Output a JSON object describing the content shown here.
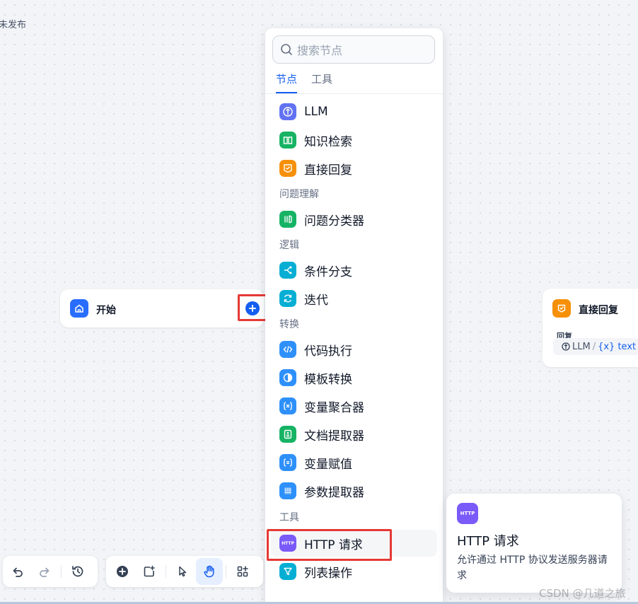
{
  "status": {
    "text": "未发布"
  },
  "start_node": {
    "title": "开始",
    "icon": "home-icon",
    "color": "#296dff"
  },
  "answer_node": {
    "title": "直接回复",
    "icon": "reply-icon",
    "color": "#f79009",
    "field_label": "回复",
    "ref_source": "LLM",
    "ref_separator": "/",
    "ref_var": "{x} text"
  },
  "panel": {
    "search_placeholder": "搜索节点",
    "tabs": [
      "节点",
      "工具"
    ],
    "items": [
      {
        "label": "LLM",
        "icon": "llm-icon",
        "color": "#6172f3"
      },
      {
        "label": "知识检索",
        "icon": "book-icon",
        "color": "#16b364"
      },
      {
        "label": "直接回复",
        "icon": "reply-icon",
        "color": "#f79009"
      },
      {
        "label": "问题分类器",
        "icon": "classifier-icon",
        "color": "#16b364"
      },
      {
        "label": "条件分支",
        "icon": "branch-icon",
        "color": "#06aed4"
      },
      {
        "label": "迭代",
        "icon": "iteration-icon",
        "color": "#06aed4"
      },
      {
        "label": "代码执行",
        "icon": "code-icon",
        "color": "#2e90fa"
      },
      {
        "label": "模板转换",
        "icon": "template-icon",
        "color": "#2e90fa"
      },
      {
        "label": "变量聚合器",
        "icon": "variable-icon",
        "color": "#2e90fa"
      },
      {
        "label": "文档提取器",
        "icon": "document-icon",
        "color": "#16b364"
      },
      {
        "label": "变量赋值",
        "icon": "assign-icon",
        "color": "#2e90fa"
      },
      {
        "label": "参数提取器",
        "icon": "parameter-icon",
        "color": "#2e90fa"
      },
      {
        "label": "HTTP 请求",
        "icon": "http-icon",
        "color": "#7a5af8"
      },
      {
        "label": "列表操作",
        "icon": "filter-icon",
        "color": "#06aed4"
      }
    ],
    "sections": [
      "问题理解",
      "逻辑",
      "转换",
      "工具"
    ]
  },
  "tooltip": {
    "icon_text": "HTTP",
    "title": "HTTP 请求",
    "description": "允许通过 HTTP 协议发送服务器请求"
  },
  "toolbar": {
    "icons": [
      "undo-icon",
      "redo-icon",
      "history-icon",
      "add-node-icon",
      "add-note-icon",
      "pointer-icon",
      "hand-icon",
      "organize-icon"
    ],
    "active": "hand-icon"
  },
  "watermark": "CSDN @几道之旅"
}
